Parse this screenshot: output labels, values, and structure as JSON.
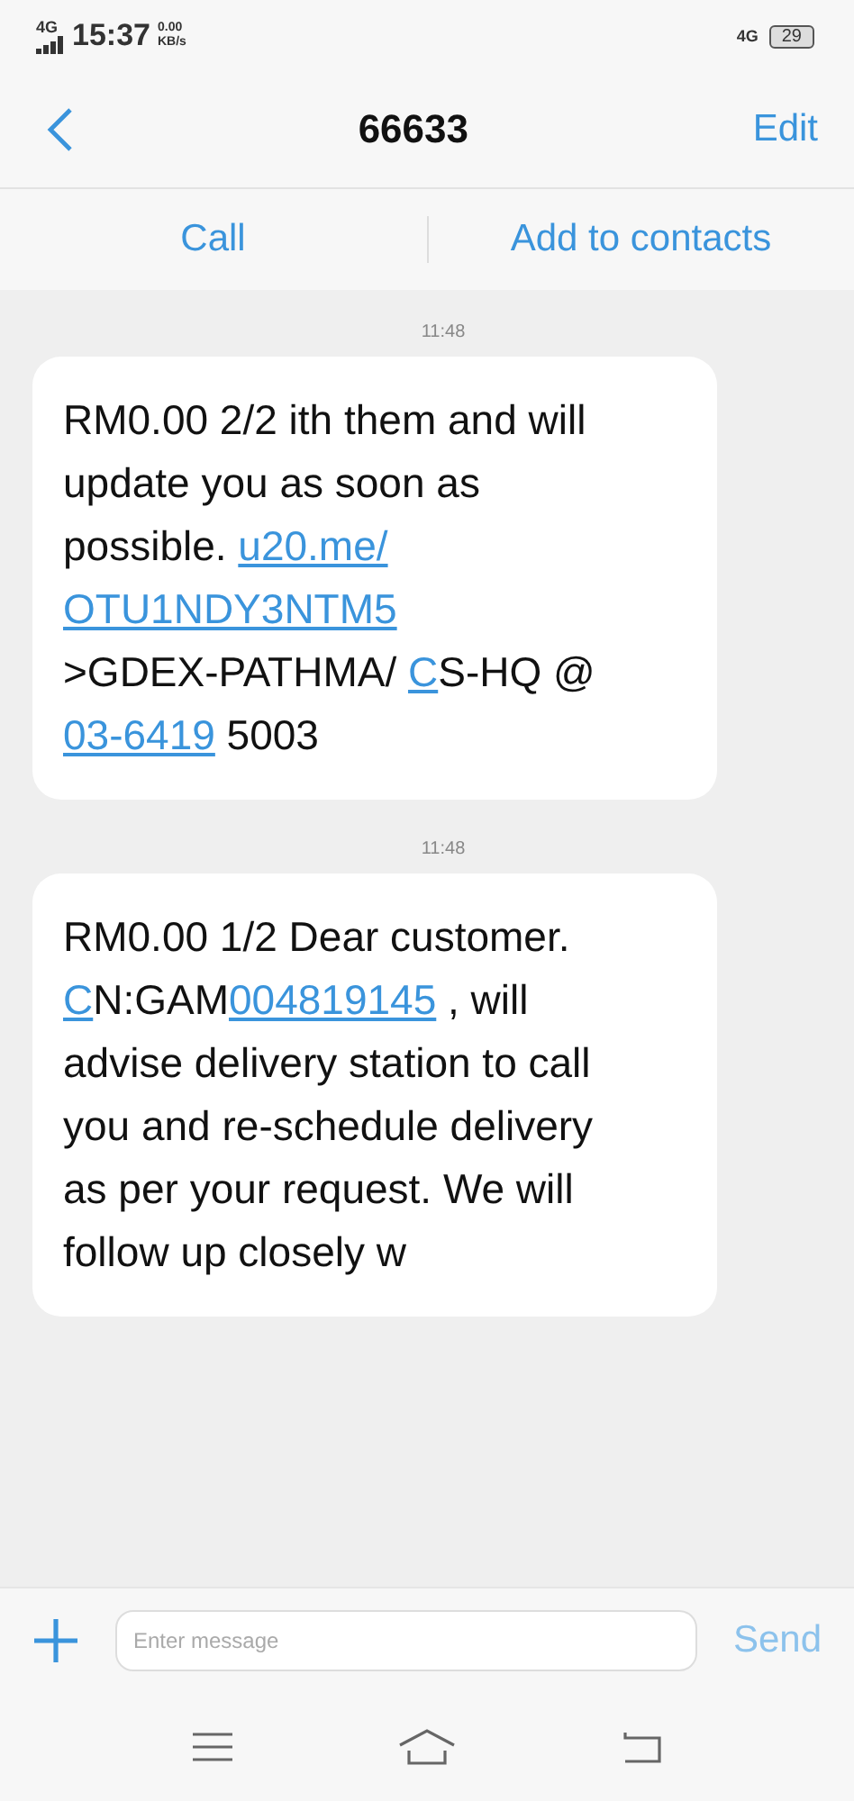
{
  "status_bar": {
    "network": "4G",
    "time": "15:37",
    "speed": "0.00",
    "speed_unit": "KB/s",
    "network_right": "4G",
    "battery": "29"
  },
  "header": {
    "title": "66633",
    "action": "Edit"
  },
  "actions": [
    "Call",
    "Add to contacts"
  ],
  "messages": [
    {
      "time": "11:48",
      "lines": [
        [
          {
            "text": "RM0.00 2/2 ith them and will",
            "link": false
          }
        ],
        [
          {
            "text": "update you as soon as",
            "link": false
          }
        ],
        [
          {
            "text": "possible.  ",
            "link": false
          },
          {
            "text": "u20.me/",
            "link": true
          }
        ],
        [
          {
            "text": "OTU1NDY3NTM5",
            "link": true
          }
        ],
        [
          {
            "text": ">GDEX-PATHMA/ ",
            "link": false
          },
          {
            "text": "C",
            "link": true
          },
          {
            "text": "S-HQ @",
            "link": false
          }
        ],
        [
          {
            "text": "03-6419",
            "link": true
          },
          {
            "text": " 5003",
            "link": false
          }
        ]
      ]
    },
    {
      "time": "11:48",
      "lines": [
        [
          {
            "text": "RM0.00 1/2 Dear customer.",
            "link": false
          }
        ],
        [
          {
            "text": "C",
            "link": true
          },
          {
            "text": "N:GAM",
            "link": false
          },
          {
            "text": "004819145",
            "link": true
          },
          {
            "text": "  , will",
            "link": false
          }
        ],
        [
          {
            "text": "advise delivery station to call",
            "link": false
          }
        ],
        [
          {
            "text": "you and re-schedule delivery",
            "link": false
          }
        ],
        [
          {
            "text": "as per your request. We will",
            "link": false
          }
        ],
        [
          {
            "text": "follow up closely w",
            "link": false
          }
        ]
      ]
    }
  ],
  "composer": {
    "placeholder": "Enter message",
    "send": "Send"
  }
}
